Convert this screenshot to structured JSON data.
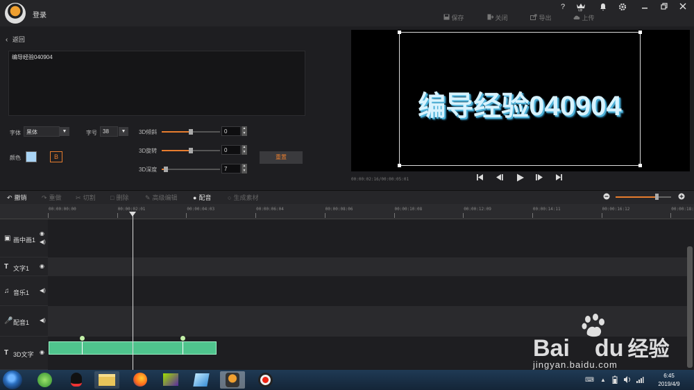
{
  "titlebar": {
    "login": "登录",
    "help": "?",
    "vip": "VIP",
    "actions": [
      {
        "label": "保存",
        "icon": "save-icon"
      },
      {
        "label": "关闭",
        "icon": "exit-icon"
      },
      {
        "label": "导出",
        "icon": "export-icon"
      },
      {
        "label": "上传",
        "icon": "upload-icon"
      }
    ]
  },
  "editor": {
    "back_label": "返回",
    "text_value": "编导经验040904",
    "font_label": "字体",
    "font_value": "黑体",
    "size_label": "字号",
    "size_value": "38",
    "color_label": "颜色",
    "color_value": "#a9d4f5",
    "bold_label": "B",
    "reset_label": "重置",
    "sliders": [
      {
        "label": "3D倾斜",
        "value": "0",
        "level": 0.5
      },
      {
        "label": "3D旋转",
        "value": "0",
        "level": 0.5
      },
      {
        "label": "3D深度",
        "value": "7",
        "level": 0.07
      }
    ]
  },
  "preview": {
    "text": "编导经验040904",
    "timecode": "00:00:02:16/00:00:05:01"
  },
  "toolbar": {
    "items": [
      {
        "label": "撤销",
        "active": true
      },
      {
        "label": "重做",
        "active": false
      },
      {
        "label": "切割",
        "active": false
      },
      {
        "label": "删除",
        "active": false
      },
      {
        "label": "高级编辑",
        "active": false
      },
      {
        "label": "配音",
        "active": true
      },
      {
        "label": "生成素材",
        "active": false
      }
    ]
  },
  "timeline": {
    "ticks": [
      "00:00:00:00",
      "00:00:02:01",
      "00:00:04:03",
      "00:00:06:04",
      "00:00:08:06",
      "00:00:10:08",
      "00:00:12:09",
      "00:00:14:11",
      "00:00:16:12",
      "00:00:18:1"
    ],
    "tracks": [
      {
        "label": "画中画1"
      },
      {
        "label": "文字1"
      },
      {
        "label": "音乐1"
      },
      {
        "label": "配音1"
      },
      {
        "label": "3D文字"
      }
    ]
  },
  "taskbar": {
    "time": "6:45",
    "date": "2019/4/9"
  },
  "watermark": {
    "brand": "Bai",
    "brand2": "du",
    "cn": "经验",
    "url": "jingyan.baidu.com"
  },
  "colors": {
    "accent": "#e87d2e",
    "clip": "#4fc48d"
  }
}
